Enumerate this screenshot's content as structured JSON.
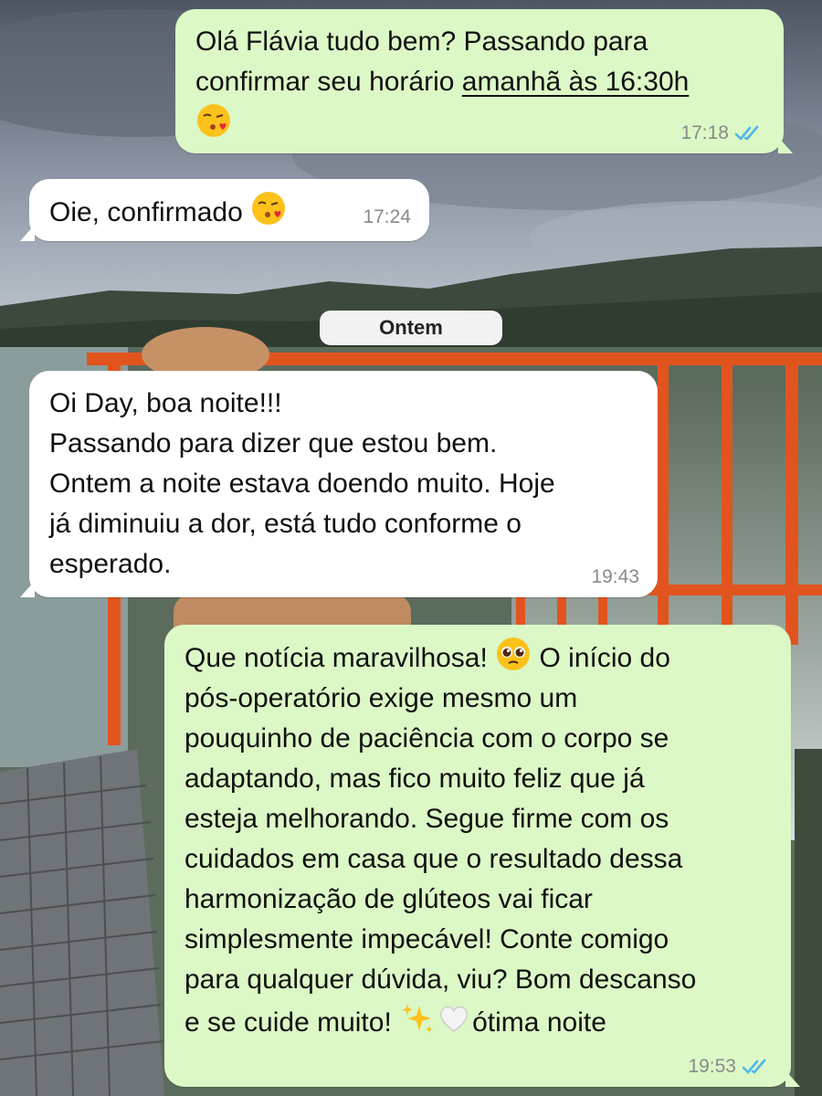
{
  "chat": {
    "date_separator": "Ontem",
    "messages": [
      {
        "direction": "outgoing",
        "lines": [
          "Olá Flávia tudo bem? Passando para",
          "confirmar seu horário ",
          "amanhã às 16:30h"
        ],
        "emojis": [
          "kissing-face-with-heart-emoji"
        ],
        "time": "17:18",
        "status": "read"
      },
      {
        "direction": "incoming",
        "text": "Oie, confirmado",
        "emojis": [
          "kissing-face-with-heart-emoji"
        ],
        "time": "17:24"
      },
      {
        "direction": "incoming",
        "lines": [
          "Oi Day, boa noite!!!",
          "Passando para dizer que estou bem.",
          "Ontem a noite estava doendo muito. Hoje",
          "já diminuiu a dor, está tudo conforme o",
          "esperado."
        ],
        "time": "19:43"
      },
      {
        "direction": "outgoing",
        "lines": [
          "Que notícia maravilhosa! ",
          " O início do",
          "pós-operatório exige mesmo um",
          "pouquinho de paciência com o corpo se",
          "adaptando, mas fico muito feliz que já",
          "esteja melhorando. Segue firme com os",
          "cuidados em casa que o resultado dessa",
          "harmonização de glúteos vai ficar",
          "simplesmente impecável! Conte comigo",
          "para qualquer dúvida, viu? Bom descanso",
          "e se cuide muito! ",
          "ótima noite"
        ],
        "emojis": [
          "pleading-face-emoji",
          "sparkles-emoji",
          "white-heart-emoji"
        ],
        "time": "19:53",
        "status": "read"
      }
    ]
  },
  "colors": {
    "outgoing_bubble": "#dcf8c6",
    "incoming_bubble": "#ffffff",
    "read_ticks": "#4fb6ec",
    "railing": "#e2541e"
  }
}
